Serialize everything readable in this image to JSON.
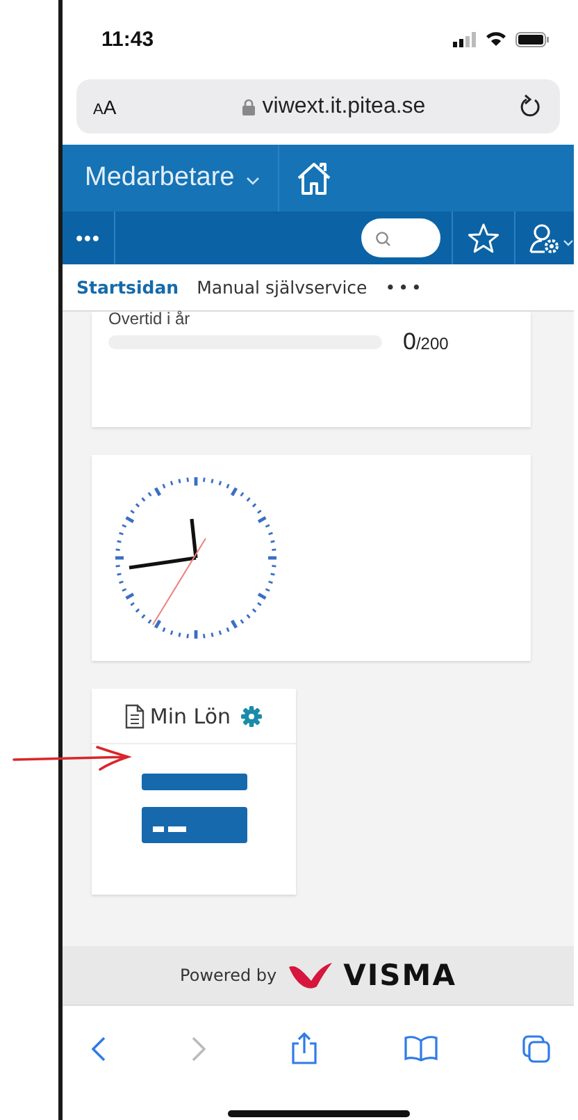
{
  "status_bar": {
    "time": "11:43"
  },
  "browser": {
    "text_size": "AA",
    "url": "viwext.it.pitea.se"
  },
  "header": {
    "module": "Medarbetare",
    "menu": "•••"
  },
  "tabs": [
    {
      "label": "Startsidan",
      "selected": true
    },
    {
      "label": "Manual självservice",
      "selected": false
    }
  ],
  "tabs_more": "•••",
  "overtime": {
    "label": "Overtid i år",
    "level": 0,
    "value": "0",
    "limit": "/200"
  },
  "salary": {
    "title": "Min Lön"
  },
  "footer": {
    "powered_by": "Powered by",
    "logo": "VISMA"
  }
}
